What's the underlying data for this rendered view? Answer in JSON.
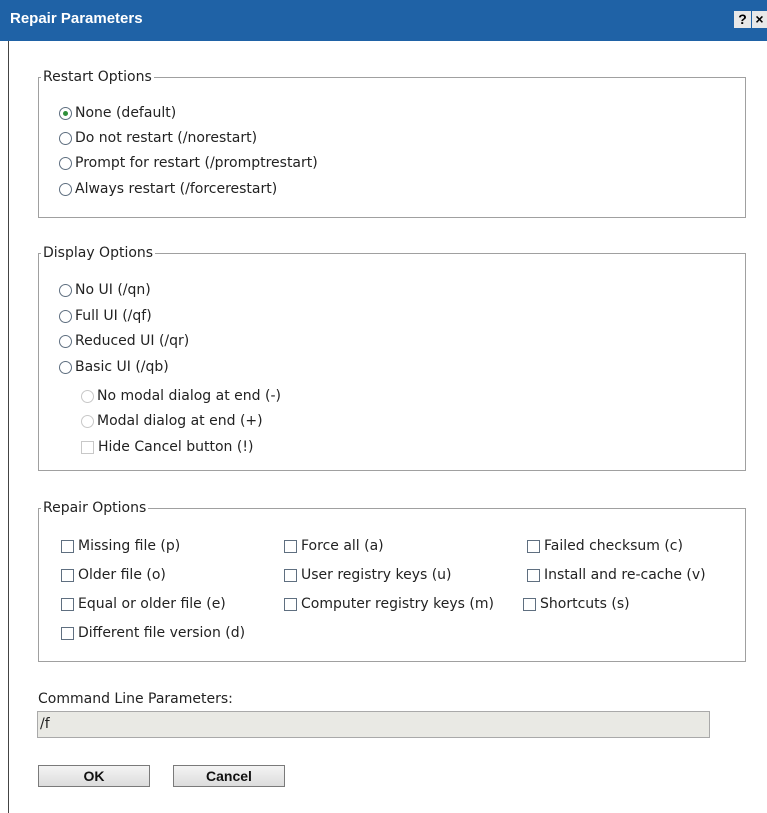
{
  "window": {
    "title": "Repair Parameters",
    "help_label": "?",
    "close_label": "×"
  },
  "restart": {
    "legend": "Restart Options",
    "options": [
      {
        "label": "None (default)",
        "checked": true
      },
      {
        "label": "Do not restart (/norestart)",
        "checked": false
      },
      {
        "label": "Prompt for restart (/promptrestart)",
        "checked": false
      },
      {
        "label": "Always restart (/forcerestart)",
        "checked": false
      }
    ]
  },
  "display": {
    "legend": "Display Options",
    "options": [
      {
        "label": "No UI (/qn)",
        "checked": false
      },
      {
        "label": "Full UI (/qf)",
        "checked": false
      },
      {
        "label": "Reduced UI (/qr)",
        "checked": false
      },
      {
        "label": "Basic UI (/qb)",
        "checked": false
      }
    ],
    "sub_options": [
      {
        "label": "No modal dialog at end (-)",
        "enabled": false
      },
      {
        "label": "Modal dialog at end (+)",
        "enabled": false
      }
    ],
    "hide_cancel_label": "Hide Cancel button (!)"
  },
  "repair": {
    "legend": "Repair Options",
    "checkboxes": [
      {
        "label": "Missing file (p)",
        "checked": false
      },
      {
        "label": "Older file (o)",
        "checked": false
      },
      {
        "label": "Equal or older file (e)",
        "checked": false
      },
      {
        "label": "Different file version (d)",
        "checked": false
      },
      {
        "label": "Force all (a)",
        "checked": false
      },
      {
        "label": "User registry keys (u)",
        "checked": false
      },
      {
        "label": "Computer registry keys (m)",
        "checked": false
      },
      {
        "label": "Failed checksum (c)",
        "checked": false
      },
      {
        "label": "Install and re-cache (v)",
        "checked": false
      },
      {
        "label": "Shortcuts (s)",
        "checked": false
      }
    ]
  },
  "command_line": {
    "label": "Command Line Parameters:",
    "value": "/f"
  },
  "buttons": {
    "ok": "OK",
    "cancel": "Cancel"
  },
  "colors": {
    "titlebar": "#1f62a6",
    "radio_selected": "#2f8f3a"
  }
}
